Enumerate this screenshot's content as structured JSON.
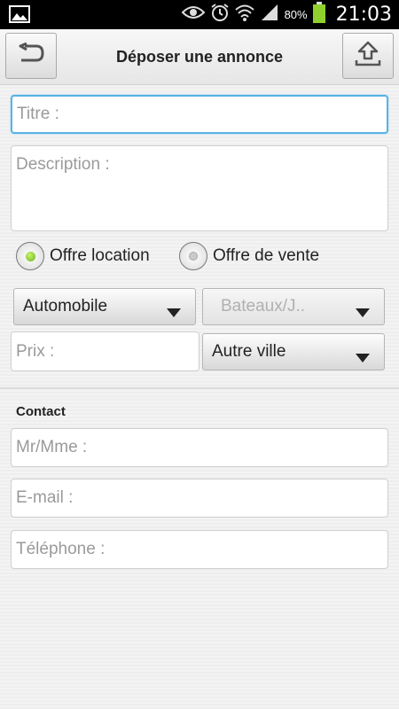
{
  "status_bar": {
    "battery_percent": "80%",
    "time": "21:03",
    "icons": [
      "image-icon",
      "eye-icon",
      "alarm-icon",
      "wifi-icon",
      "signal-icon",
      "battery-icon"
    ]
  },
  "header": {
    "title": "Déposer une annonce",
    "back_icon": "back-arrow-icon",
    "upload_icon": "upload-icon"
  },
  "form": {
    "title_placeholder": "Titre :",
    "description_placeholder": "Description :",
    "offer_type": {
      "options": [
        "Offre location",
        "Offre de vente"
      ],
      "selected": "Offre location"
    },
    "category_value": "Automobile",
    "subcategory_value": "Bateaux/J..",
    "price_placeholder": "Prix :",
    "city_value": "Autre ville"
  },
  "contact": {
    "label": "Contact",
    "name_placeholder": "Mr/Mme :",
    "email_placeholder": "E-mail :",
    "phone_placeholder": "Téléphone :"
  },
  "colors": {
    "focus_border": "#58b2e6",
    "radio_selected": "#8fd12c"
  }
}
